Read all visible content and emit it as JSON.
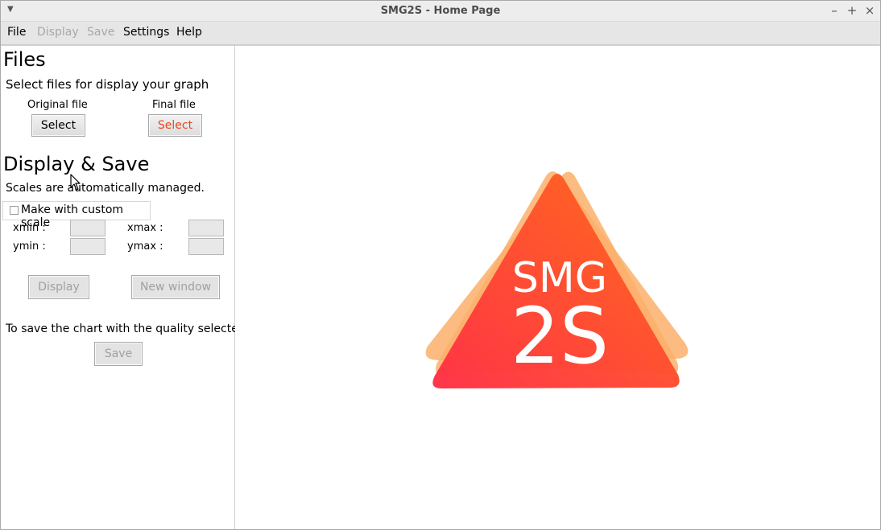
{
  "window": {
    "title": "SMG2S - Home Page"
  },
  "menubar": {
    "items": [
      {
        "label": "File",
        "enabled": true
      },
      {
        "label": "Display",
        "enabled": false
      },
      {
        "label": "Save",
        "enabled": false
      },
      {
        "label": "Settings",
        "enabled": true
      },
      {
        "label": "Help",
        "enabled": true
      }
    ]
  },
  "files": {
    "heading": "Files",
    "description": "Select files for display your graph",
    "original_label": "Original file",
    "original_button": "Select",
    "final_label": "Final file",
    "final_button": "Select"
  },
  "display_save": {
    "heading": "Display & Save",
    "scales_note": "Scales are automatically managed.",
    "custom_scale_label": "Make with custom scale",
    "custom_scale_checked": false,
    "xmin_label": "xmin :",
    "xmax_label": "xmax :",
    "ymin_label": "ymin :",
    "ymax_label": "ymax :",
    "xmin_value": "",
    "xmax_value": "",
    "ymin_value": "",
    "ymax_value": "",
    "display_button": "Display",
    "new_window_button": "New window",
    "save_note": "To save the chart with the quality selected",
    "save_button": "Save"
  },
  "logo": {
    "line1": "SMG",
    "line2": "2S",
    "colors": {
      "back": "#fbb06b",
      "front_start": "#ff2f45",
      "front_end": "#ff6a1a"
    }
  },
  "colors": {
    "accent_red": "#e8471c",
    "disabled_text": "#a8a8a8"
  }
}
